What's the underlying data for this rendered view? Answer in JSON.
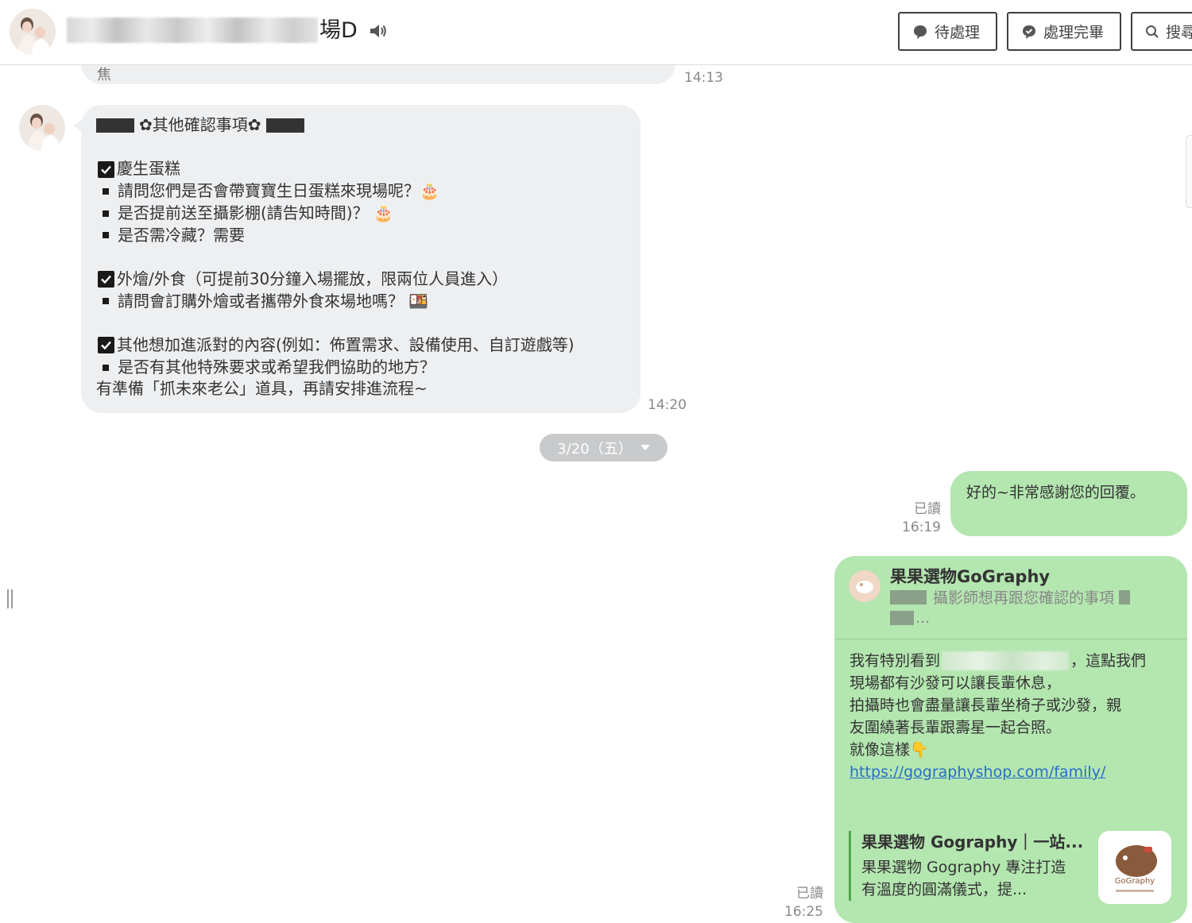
{
  "header": {
    "title_suffix": "場D",
    "buttons": {
      "pending": "待處理",
      "done": "處理完畢",
      "search": "搜尋"
    }
  },
  "messages": {
    "prev_time": "14:13",
    "prev_cut_text": "焦",
    "checklist": {
      "heading": "✿其他確認事項✿",
      "section1_title": "慶生蛋糕",
      "section1_items": [
        "請問您們是否會帶寶寶生日蛋糕來現場呢？🎂",
        "是否提前送至攝影棚(請告知時間)？ 🎂",
        "是否需冷藏？需要"
      ],
      "section2_title": "外燴/外食（可提前30分鐘入場擺放，限兩位人員進入）",
      "section2_items": [
        "請問會訂購外燴或者攜帶外食來場地嗎？ 🍱"
      ],
      "section3_title": "其他想加進派對的內容(例如：佈置需求、設備使用、自訂遊戲等)",
      "section3_items": [
        "是否有其他特殊要求或希望我們協助的地方？"
      ],
      "note": "有準備「抓未來老公」道具，再請安排進流程~",
      "time": "14:20"
    },
    "date_divider": "3/20（五）",
    "reply": {
      "text": "好的~非常感謝您的回覆。",
      "read": "已讀",
      "time": "16:19"
    },
    "card": {
      "name": "果果選物GoGraphy",
      "subtitle": "攝影師想再跟您確認的事項",
      "subtitle_more": "...",
      "body_line1_a": "我有特別看到",
      "body_line1_b": "，這點我們",
      "body_line2": "現場都有沙發可以讓長輩休息，",
      "body_line3": "拍攝時也會盡量讓長輩坐椅子或沙發，親",
      "body_line4": "友圍繞著長輩跟壽星一起合照。",
      "body_line5": "就像這樣👇",
      "link": "https://gographyshop.com/family/",
      "preview_title": "果果選物 Gography｜一站...",
      "preview_desc": "果果選物 Gography 專注打造有溫度的圓滿儀式，提...",
      "thumb_label": "GoGraphy",
      "read": "已讀",
      "time": "16:25"
    }
  },
  "colors": {
    "incoming_bubble": "#eeeff1",
    "outgoing_bubble": "#b4e6b0",
    "link": "#2a6ec7"
  },
  "icons": [
    "avatar",
    "speaker-icon",
    "chat-bubble-icon",
    "check-bubble-icon",
    "search-icon",
    "checkbox-icon",
    "caret-down-icon"
  ]
}
